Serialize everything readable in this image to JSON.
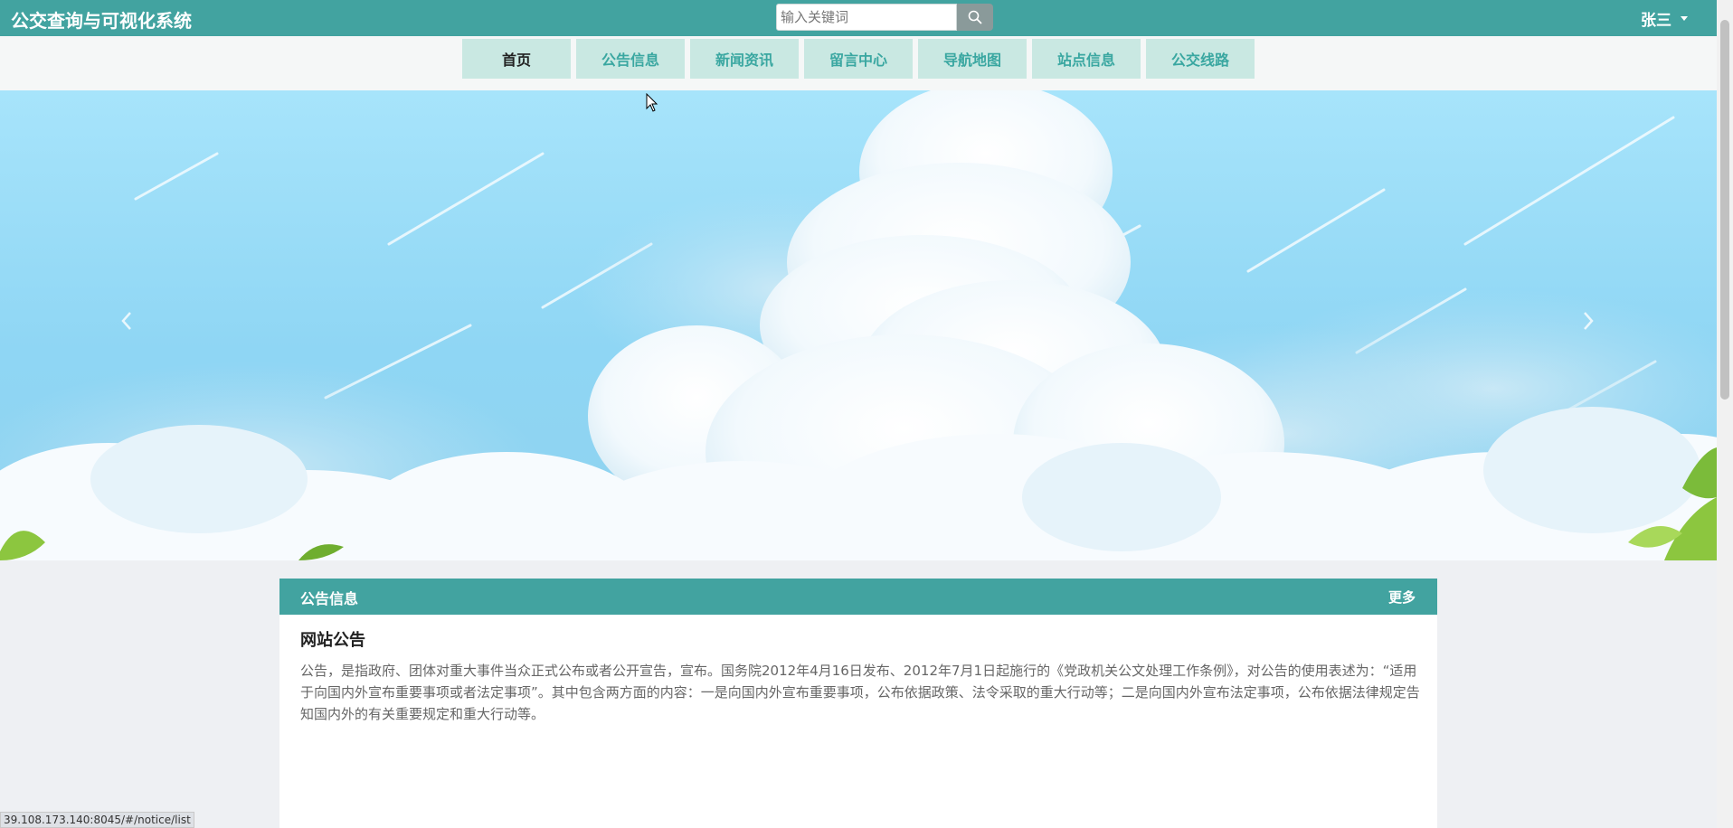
{
  "header": {
    "site_title": "公交查询与可视化系统",
    "search_placeholder": "输入关键词",
    "user_name": "张三"
  },
  "nav": {
    "items": [
      {
        "label": "首页"
      },
      {
        "label": "公告信息"
      },
      {
        "label": "新闻资讯"
      },
      {
        "label": "留言中心"
      },
      {
        "label": "导航地图"
      },
      {
        "label": "站点信息"
      },
      {
        "label": "公交线路"
      }
    ],
    "active_index": 0
  },
  "notice_panel": {
    "title": "公告信息",
    "more_label": "更多",
    "notice_title": "网站公告",
    "notice_body": "公告，是指政府、团体对重大事件当众正式公布或者公开宣告，宣布。国务院2012年4月16日发布、2012年7月1日起施行的《党政机关公文处理工作条例》，对公告的使用表述为：“适用于向国内外宣布重要事项或者法定事项”。其中包含两方面的内容：一是向国内外宣布重要事项，公布依据政策、法令采取的重大行动等；二是向国内外宣布法定事项，公布依据法律规定告知国内外的有关重要规定和重大行动等。"
  },
  "status_bar": {
    "url": "39.108.173.140:8045/#/notice/list"
  },
  "colors": {
    "primary": "#42a3a0",
    "nav_bg": "#c9e8e2",
    "nav_text": "#3aa7a1",
    "sky": "#9ddcf7"
  },
  "icons": {
    "search": "search-icon",
    "caret": "chevron-down-icon",
    "prev": "chevron-left-icon",
    "next": "chevron-right-icon"
  }
}
